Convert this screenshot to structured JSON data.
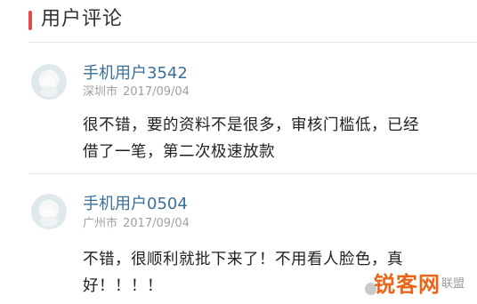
{
  "header": {
    "title": "用户评论"
  },
  "comments": [
    {
      "username": "手机用户3542",
      "city": "深圳市",
      "date": "2017/09/04",
      "text": "很不错，要的资料不是很多，审核门槛低，已经借了一笔，第二次极速放款"
    },
    {
      "username": "手机用户0504",
      "city": "广州市",
      "date": "2017/09/04",
      "text": "不错，很顺利就批下来了！不用看人脸色，真好！！！！"
    }
  ],
  "watermark": {
    "brand": "锐客网",
    "sub": "联盟"
  },
  "colors": {
    "accent": "#e04b4b",
    "username": "#3a6f9a",
    "meta": "#a0a0a0",
    "watermark": "#e8661a"
  }
}
